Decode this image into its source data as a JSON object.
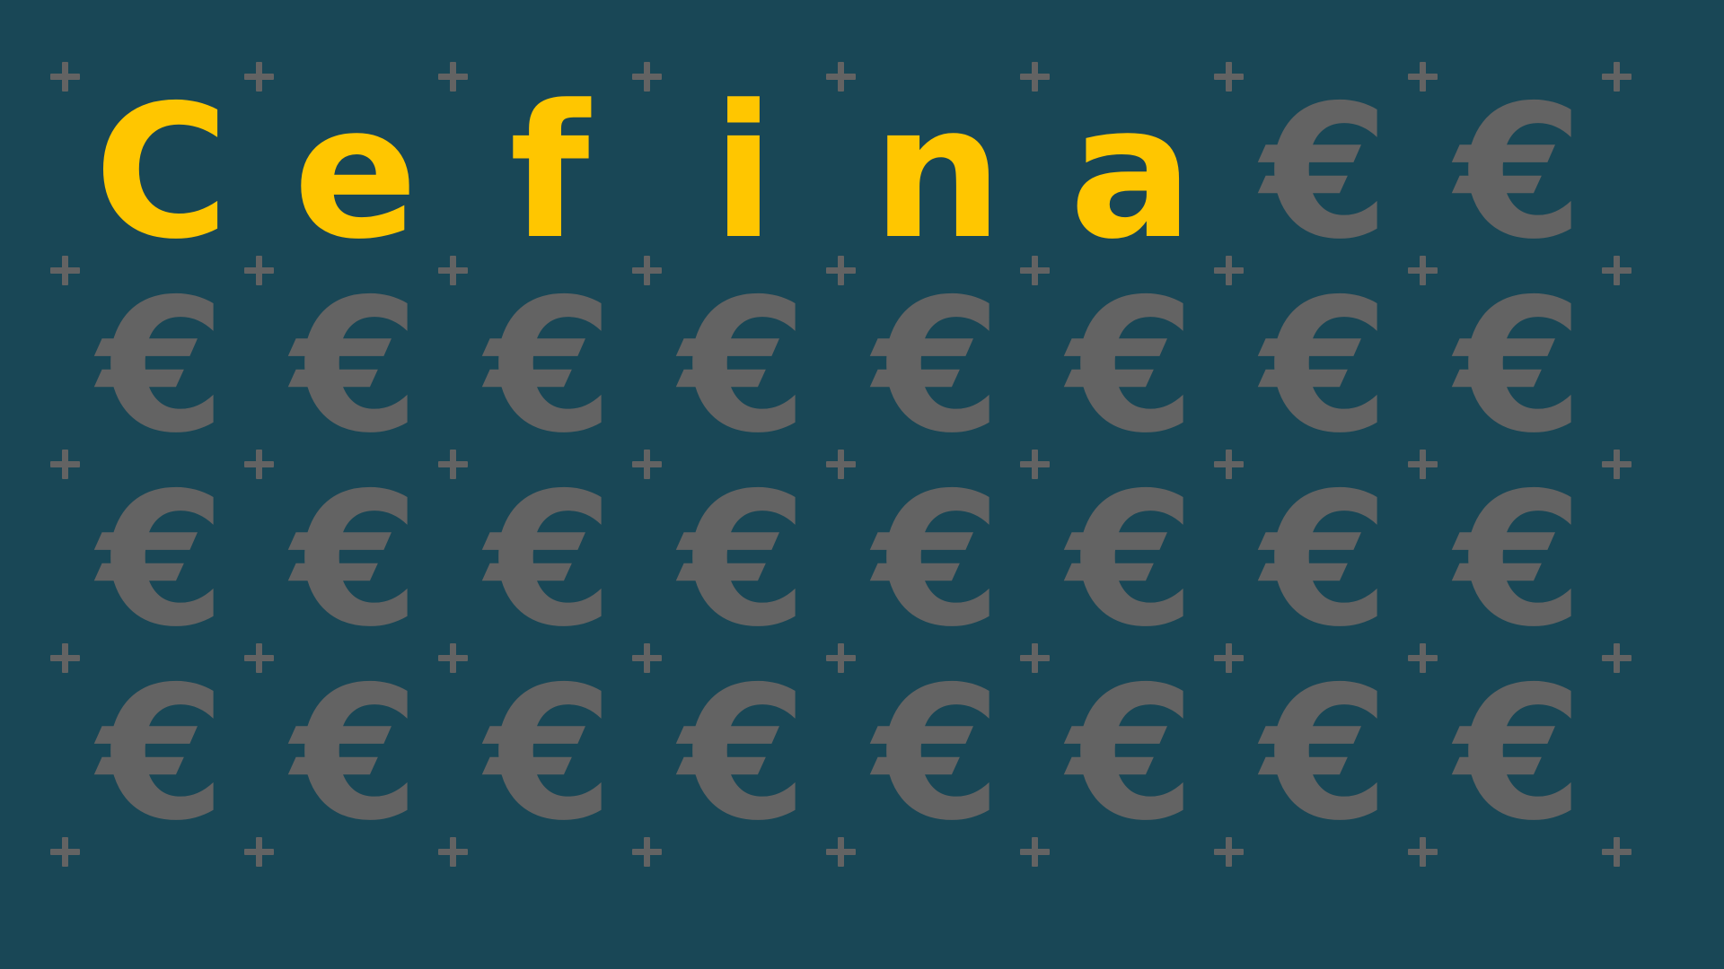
{
  "colors": {
    "background": "#194756",
    "letter": "#FFC600",
    "euro": "#636363",
    "plus": "#636363"
  },
  "grid": {
    "rows": 4,
    "cols": 8
  },
  "glyphs": [
    "C",
    "e",
    "f",
    "i",
    "n",
    "a",
    "€",
    "€",
    "€",
    "€",
    "€",
    "€",
    "€",
    "€",
    "€",
    "€",
    "€",
    "€",
    "€",
    "€",
    "€",
    "€",
    "€",
    "€",
    "€",
    "€",
    "€",
    "€",
    "€",
    "€",
    "€",
    "€"
  ],
  "highlight_count": 6
}
